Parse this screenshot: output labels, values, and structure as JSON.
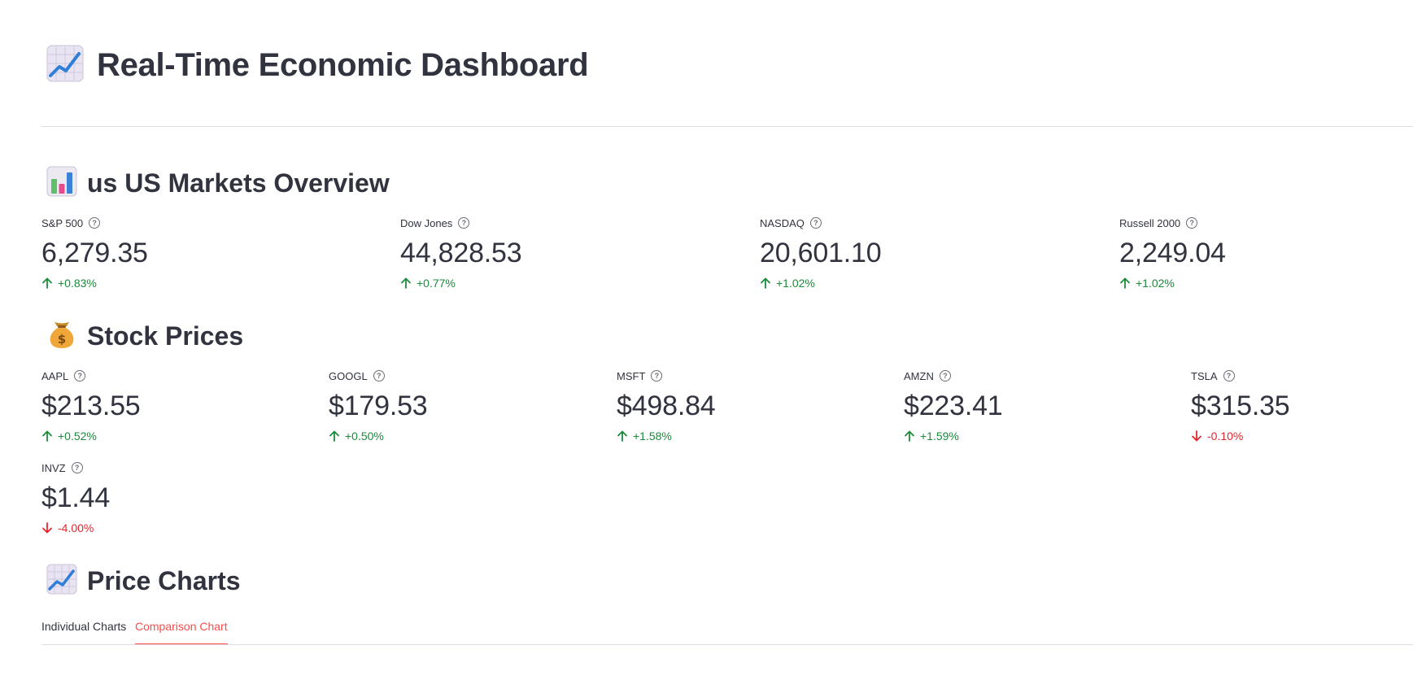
{
  "page": {
    "title_emoji": "chart-increasing-icon",
    "title": "Real-Time Economic Dashboard"
  },
  "markets": {
    "emoji": "bar-chart-icon",
    "title": "us US Markets Overview",
    "items": [
      {
        "label": "S&P 500",
        "value": "6,279.35",
        "delta": "+0.83%",
        "direction": "up"
      },
      {
        "label": "Dow Jones",
        "value": "44,828.53",
        "delta": "+0.77%",
        "direction": "up"
      },
      {
        "label": "NASDAQ",
        "value": "20,601.10",
        "delta": "+1.02%",
        "direction": "up"
      },
      {
        "label": "Russell 2000",
        "value": "2,249.04",
        "delta": "+1.02%",
        "direction": "up"
      }
    ]
  },
  "stocks": {
    "emoji": "money-bag-icon",
    "title": "Stock Prices",
    "items": [
      {
        "label": "AAPL",
        "value": "$213.55",
        "delta": "+0.52%",
        "direction": "up"
      },
      {
        "label": "GOOGL",
        "value": "$179.53",
        "delta": "+0.50%",
        "direction": "up"
      },
      {
        "label": "MSFT",
        "value": "$498.84",
        "delta": "+1.58%",
        "direction": "up"
      },
      {
        "label": "AMZN",
        "value": "$223.41",
        "delta": "+1.59%",
        "direction": "up"
      },
      {
        "label": "TSLA",
        "value": "$315.35",
        "delta": "-0.10%",
        "direction": "down"
      },
      {
        "label": "INVZ",
        "value": "$1.44",
        "delta": "-4.00%",
        "direction": "down"
      }
    ]
  },
  "charts": {
    "emoji": "chart-increasing-icon",
    "title": "Price Charts",
    "tabs": [
      {
        "label": "Individual Charts",
        "active": false
      },
      {
        "label": "Comparison Chart",
        "active": true
      }
    ]
  },
  "colors": {
    "up": "#1b8a3a",
    "down": "#e4262e",
    "accent": "#ff4b4b",
    "text": "#31333f"
  },
  "help_glyph": "?"
}
